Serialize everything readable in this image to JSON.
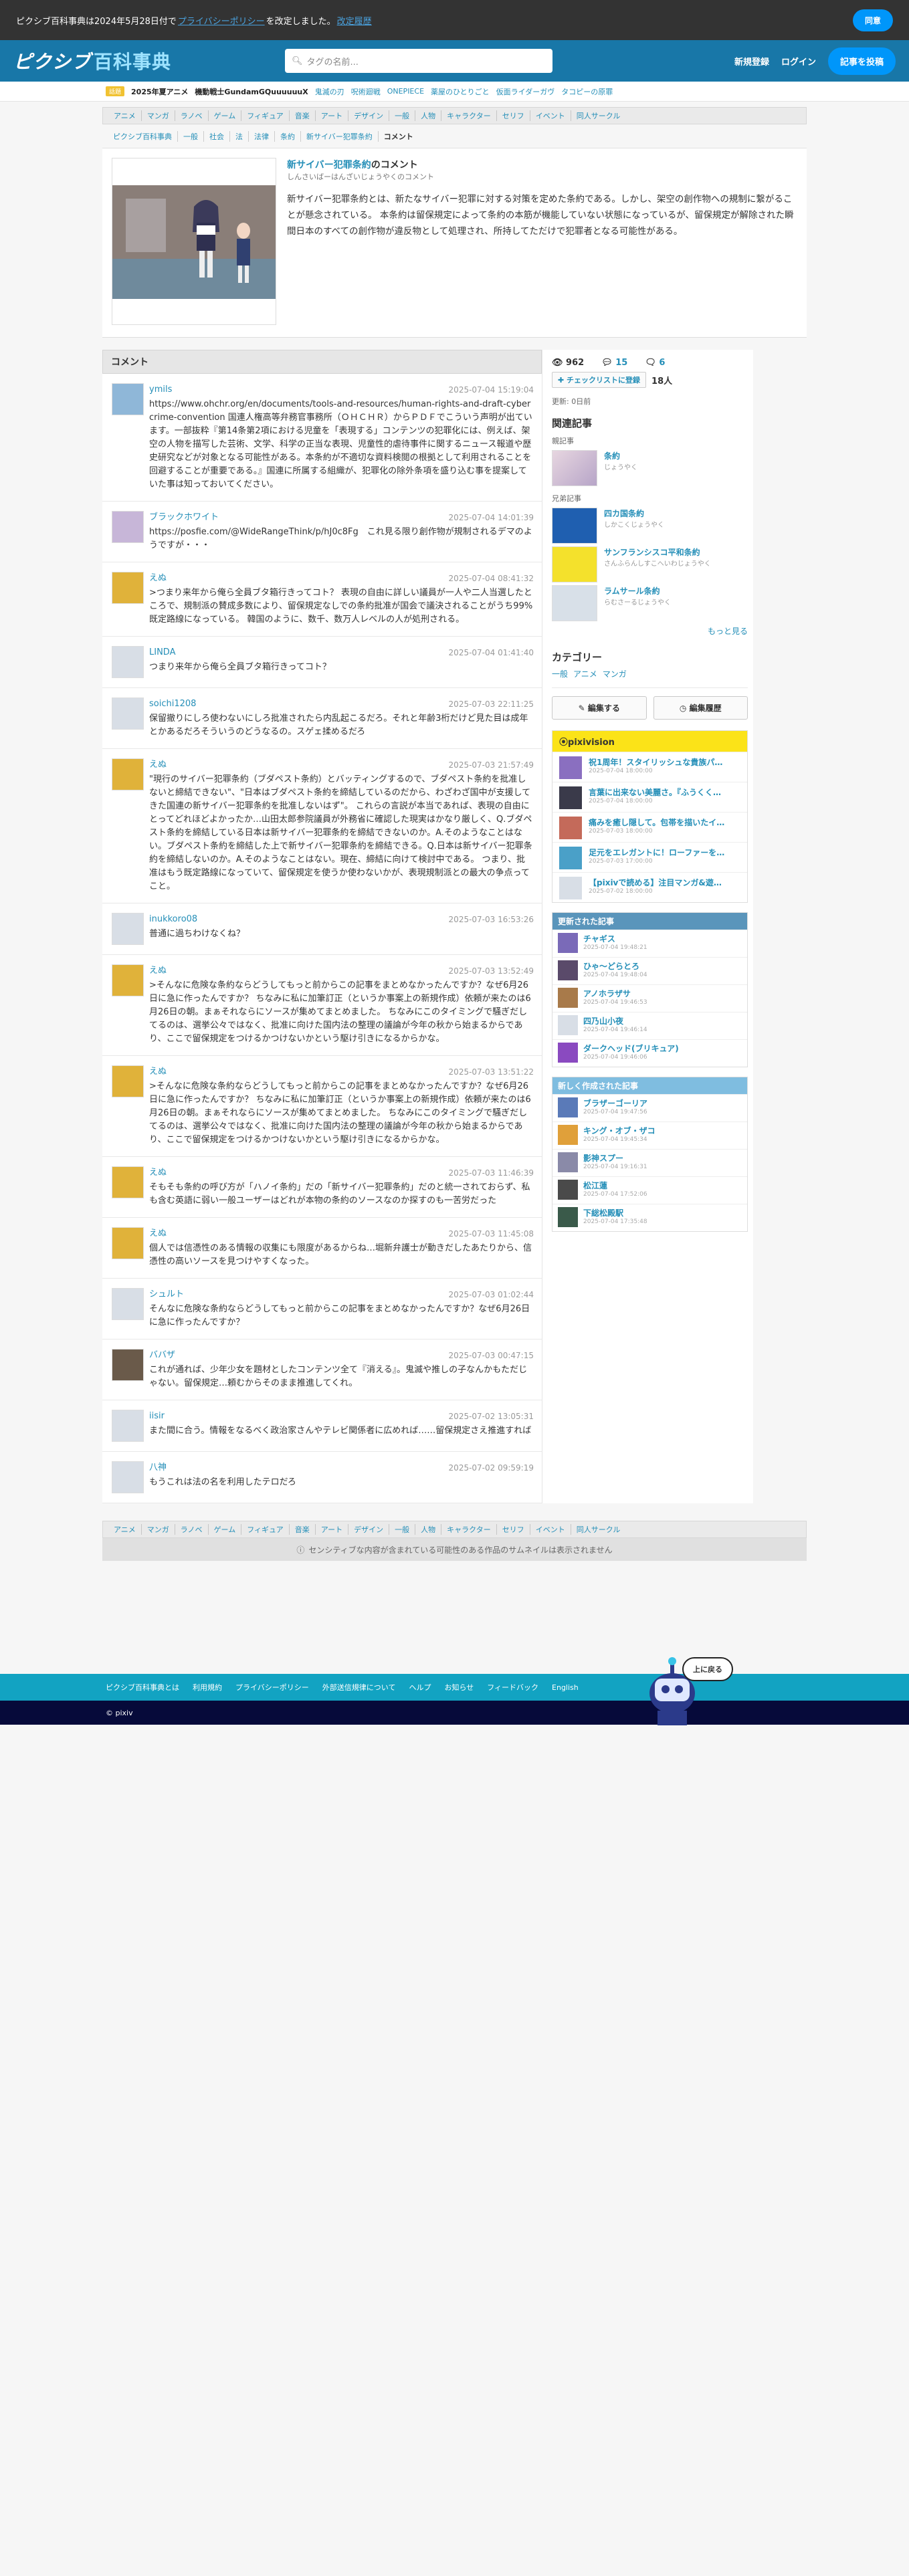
{
  "notice": {
    "text1": "ピクシブ百科事典は2024年5月28日付で",
    "policy_link": "プライバシーポリシー",
    "text2": "を改定しました。",
    "history_link": "改定履歴",
    "agree": "同意"
  },
  "header": {
    "logo_main": "ピクシブ",
    "logo_sub": "百科事典",
    "search_placeholder": "タグの名前...",
    "signup": "新規登録",
    "login": "ログイン",
    "write": "記事を投稿"
  },
  "trend": {
    "badge": "話題",
    "items": [
      "2025年夏アニメ",
      "機動戦士GundamGQuuuuuuX",
      "鬼滅の刃",
      "呪術廻戦",
      "ONEPIECE",
      "薬屋のひとりごと",
      "仮面ライダーガヴ",
      "タコピーの原罪"
    ]
  },
  "categories": [
    "アニメ",
    "マンガ",
    "ラノベ",
    "ゲーム",
    "フィギュア",
    "音楽",
    "アート",
    "デザイン",
    "一般",
    "人物",
    "キャラクター",
    "セリフ",
    "イベント",
    "同人サークル"
  ],
  "breadcrumb": {
    "items": [
      "ピクシブ百科事典",
      "一般",
      "社会",
      "法",
      "法律",
      "条約",
      "新サイバー犯罪条約"
    ],
    "current": "コメント"
  },
  "article": {
    "title": "新サイバー犯罪条約",
    "title_suffix": "のコメント",
    "reading": "しんさいばーはんざいじょうやくのコメント",
    "summary": "新サイバー犯罪条約とは、新たなサイバー犯罪に対する対策を定めた条約である。しかし、架空の創作物への規制に繋がることが懸念されている。 本条約は留保規定によって条約の本筋が機能していない状態になっているが、留保規定が解除された瞬間日本のすべての創作物が違反物として処理され、所持してただけで犯罪者となる可能性がある。"
  },
  "comments_title": "コメント",
  "comments": [
    {
      "name": "ymils",
      "date": "2025-07-04 15:19:04",
      "text": "https://www.ohchr.org/en/documents/tools-and-resources/human-rights-and-draft-cybercrime-convention 国連人権高等弁務官事務所（ＯＨＣＨＲ）からＰＤＦでこういう声明が出ています。一部抜粋『第14条第2項における児童を「表現する」コンテンツの犯罪化には、例えば、架空の人物を描写した芸術、文学、科学の正当な表現、児童性的虐待事件に関するニュース報道や歴史研究などが対象となる可能性がある。本条約が不適切な資料検閲の根拠として利用されることを回避することが重要である。』国連に所属する組織が、犯罪化の除外条項を盛り込む事を提案していた事は知っておいてください。"
    },
    {
      "name": "ブラックホワイト",
      "date": "2025-07-04 14:01:39",
      "text": "https://posfie.com/@WideRangeThink/p/hJ0c8Fg　これ見る限り創作物が規制されるデマのようですが・・・"
    },
    {
      "name": "えぬ",
      "date": "2025-07-04 08:41:32",
      "text": ">つまり来年から俺ら全員ブタ箱行きってコト？ 表現の自由に詳しい議員が一人や二人当選したところで、規制派の賛成多数により、留保規定なしでの条約批准が国会で議決されることがうち99%既定路線になっている。 韓国のように、数千、数万人レベルの人が処刑される。"
    },
    {
      "name": "LINDA",
      "date": "2025-07-04 01:41:40",
      "text": "つまり来年から俺ら全員ブタ箱行きってコト？"
    },
    {
      "name": "soichi1208",
      "date": "2025-07-03 22:11:25",
      "text": "保留撤りにしろ使わないにしろ批准されたら内乱起こるだろ。それと年齢3桁だけど見た目は成年とかあるだろそういうのどうなるの。スゲェ揉めるだろ"
    },
    {
      "name": "えぬ",
      "date": "2025-07-03 21:57:49",
      "text": "\"現行のサイバー犯罪条約（ブダペスト条約）とバッティングするので、ブダペスト条約を批准しないと締結できない\"、\"日本はブダペスト条約を締結しているのだから、わざわざ国中が支援してきた国連の新サイバー犯罪条約を批准しないはず\"。 これらの言説が本当であれば、表現の自由にとってどれほどよかったか…山田太郎参院議員が外務省に確認した現実はかなり厳しく、Q.ブダペスト条約を締結している日本は新サイバー犯罪条約を締結できないのか。A.そのようなことはない。ブダペスト条約を締結した上で新サイバー犯罪条約を締結できる。Q.日本は新サイバー犯罪条約を締結しないのか。A.そのようなことはない。現在、締結に向けて検討中である。 つまり、批准はもう既定路線になっていて、留保規定を使うか使わないかが、表現規制派との最大の争点ってこと。"
    },
    {
      "name": "inukkoro08",
      "date": "2025-07-03 16:53:26",
      "text": "普通に過ちわけなくね？"
    },
    {
      "name": "えぬ",
      "date": "2025-07-03 13:52:49",
      "text": ">そんなに危険な条約ならどうしてもっと前からこの記事をまとめなかったんですか？なぜ6月26日に急に作ったんですか？ ちなみに私に加筆訂正（というか事案上の新規作成）依頼が来たのは6月26日の朝。まぁそれならにソースが集めてまとめました。 ちなみにこのタイミングで騒ぎだしてるのは、選挙公々ではなく、批准に向けた国内法の整理の議論が今年の秋から始まるからであり、ここで留保規定をつけるかつけないかという駆け引きになるからかな。"
    },
    {
      "name": "えぬ",
      "date": "2025-07-03 13:51:22",
      "text": ">そんなに危険な条約ならどうしてもっと前からこの記事をまとめなかったんですか？なぜ6月26日に急に作ったんですか？ ちなみに私に加筆訂正（というか事案上の新規作成）依頼が来たのは6月26日の朝。まぁそれならにソースが集めてまとめました。 ちなみにこのタイミングで騒ぎだしてるのは、選挙公々ではなく、批准に向けた国内法の整理の議論が今年の秋から始まるからであり、ここで留保規定をつけるかつけないかという駆け引きになるからかな。"
    },
    {
      "name": "えぬ",
      "date": "2025-07-03 11:46:39",
      "text": "そもそも条約の呼び方が「ハノイ条約」だの「新サイバー犯罪条約」だのと統一されておらず、私も含む英語に弱い一般ユーザーはどれが本物の条約のソースなのか探すのも一苦労だった"
    },
    {
      "name": "えぬ",
      "date": "2025-07-03 11:45:08",
      "text": "個人では信憑性のある情報の収集にも限度があるからね…堀新弁護士が動きだしたあたりから、信憑性の高いソースを見つけやすくなった。"
    },
    {
      "name": "シュルト",
      "date": "2025-07-03 01:02:44",
      "text": "そんなに危険な条約ならどうしてもっと前からこの記事をまとめなかったんですか？なぜ6月26日に急に作ったんですか？"
    },
    {
      "name": "ババザ",
      "date": "2025-07-03 00:47:15",
      "text": "これが通れば、少年少女を題材としたコンテンツ全て『消える』。鬼滅や推しの子なんかもただじゃない。留保規定…頼むからそのまま推進してくれ。"
    },
    {
      "name": "iisir",
      "date": "2025-07-02 13:05:31",
      "text": "また間に合う。情報をなるべく政治家さんやテレビ関係者に広めれば……留保規定さえ推進すれば"
    },
    {
      "name": "八神",
      "date": "2025-07-02 09:59:19",
      "text": "もうこれは法の名を利用したテロだろ"
    }
  ],
  "sidebar": {
    "views": "962",
    "comments": "15",
    "pics": "6",
    "checklist": "チェックリストに登録",
    "checklist_count": "18人",
    "updated": "更新: 0日前",
    "related_title": "関連記事",
    "parent_label": "親記事",
    "sibling_label": "兄弟記事",
    "parent": [
      {
        "title": "条約",
        "reading": "じょうやく"
      }
    ],
    "siblings": [
      {
        "title": "四カ国条約",
        "reading": "しかこくじょうやく"
      },
      {
        "title": "サンフランシスコ平和条約",
        "reading": "さんふらんしすこへいわじょうやく"
      },
      {
        "title": "ラムサール条約",
        "reading": "らむさーるじょうやく"
      }
    ],
    "more": "もっと見る",
    "cat_title": "カテゴリー",
    "cats": [
      "一般",
      "アニメ",
      "マンガ"
    ],
    "edit": "編集する",
    "history": "編集履歴"
  },
  "pixivision": {
    "title": "pixivision",
    "items": [
      {
        "t": "祝1周年！スタイリッシュな貴族パ…",
        "d": "2025-07-04 18:00:00"
      },
      {
        "t": "言葉に出来ない美麗さ。『ふうくく…",
        "d": "2025-07-04 18:00:00"
      },
      {
        "t": "痛みを癒し隠して。包帯を描いたイ…",
        "d": "2025-07-03 18:00:00"
      },
      {
        "t": "足元をエレガントに！ローファーを…",
        "d": "2025-07-03 17:00:00"
      },
      {
        "t": "【pixivで読める】注目マンガ&遊…",
        "d": "2025-07-02 18:00:00"
      }
    ]
  },
  "updated_articles": {
    "title": "更新された記事",
    "items": [
      {
        "t": "チャギス",
        "d": "2025-07-04 19:48:21"
      },
      {
        "t": "ひゃ〜どらとろ",
        "d": "2025-07-04 19:48:04"
      },
      {
        "t": "アノホラザサ",
        "d": "2025-07-04 19:46:53"
      },
      {
        "t": "四乃山小夜",
        "d": "2025-07-04 19:46:14"
      },
      {
        "t": "ダークヘッド(ブリキュア)",
        "d": "2025-07-04 19:46:06"
      }
    ]
  },
  "new_articles": {
    "title": "新しく作成された記事",
    "items": [
      {
        "t": "ブラザーゴーリア",
        "d": "2025-07-04 19:47:56"
      },
      {
        "t": "キング・オブ・ザコ",
        "d": "2025-07-04 19:45:34"
      },
      {
        "t": "影神スプー",
        "d": "2025-07-04 19:16:31"
      },
      {
        "t": "松江蓮",
        "d": "2025-07-04 17:52:06"
      },
      {
        "t": "下総松殿駅",
        "d": "2025-07-04 17:35:48"
      }
    ]
  },
  "sensitive_note": "センシティブな内容が含まれている可能性のある作品のサムネイルは表示されません",
  "footer": {
    "links": [
      "ピクシブ百科事典とは",
      "利用規約",
      "プライバシーポリシー",
      "外部送信規律について",
      "ヘルプ",
      "お知らせ",
      "フィードバック",
      "English"
    ],
    "copyright": "© pixiv",
    "totop": "上に戻る"
  }
}
